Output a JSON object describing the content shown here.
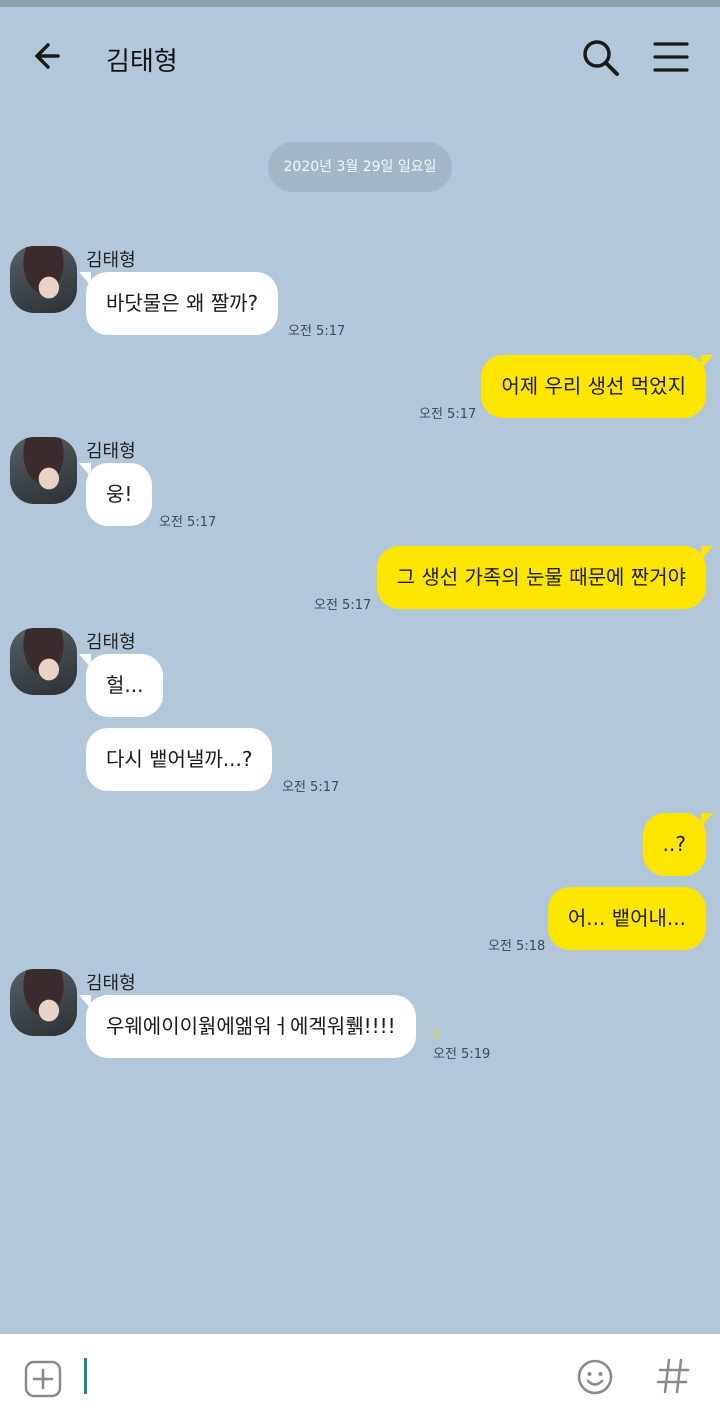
{
  "header": {
    "title": "김태형"
  },
  "date_divider": "2020년 3월 29일 일요일",
  "messages": [
    {
      "sender": "김태형",
      "text": "바닷물은 왜 짤까?",
      "time": "오전 5:17"
    },
    {
      "sender": "me",
      "text": "어제 우리 생선 먹었지",
      "time": "오전 5:17"
    },
    {
      "sender": "김태형",
      "text": "웅!",
      "time": "오전 5:17"
    },
    {
      "sender": "me",
      "text": "그 생선 가족의 눈물 때문에 짠거야",
      "time": "오전 5:17"
    },
    {
      "sender": "김태형",
      "text": "헐...",
      "time": ""
    },
    {
      "sender": "김태형",
      "text": "다시 뱉어낼까...?",
      "time": "오전 5:17"
    },
    {
      "sender": "me",
      "text": "..?",
      "time": ""
    },
    {
      "sender": "me",
      "text": "어... 뱉어내...",
      "time": "오전 5:18"
    },
    {
      "sender": "김태형",
      "text": "우웨에이이웕에엚워ㅓ에겍워뤩!!!!",
      "time": "오전 5:19",
      "unread": "1"
    }
  ],
  "input": {
    "value": ""
  },
  "icons": {
    "back": "arrow-left-icon",
    "search": "search-icon",
    "menu": "hamburger-menu-icon",
    "attach": "plus-icon",
    "emoji": "emoji-icon",
    "hashtag": "hashtag-icon"
  },
  "colors": {
    "background": "#b2c7da",
    "outgoing_bubble": "#fee600",
    "incoming_bubble": "#ffffff",
    "unread_badge": "#f2d600"
  }
}
